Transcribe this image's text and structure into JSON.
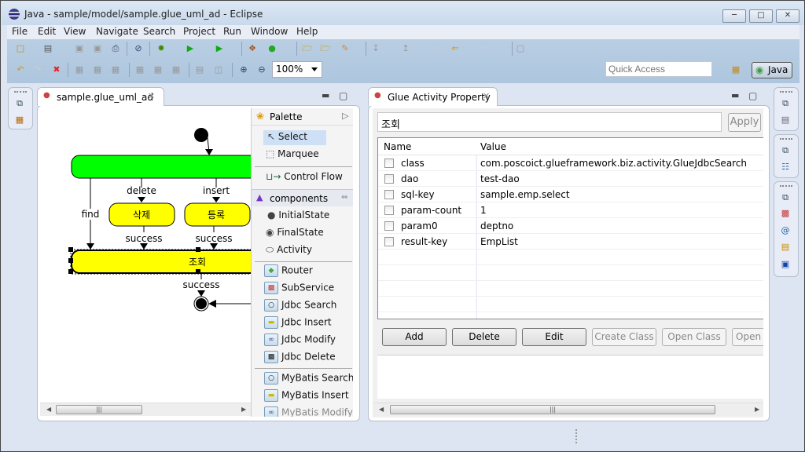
{
  "window": {
    "title": "Java - sample/model/sample.glue_uml_ad - Eclipse",
    "controls": [
      "minimize",
      "maximize",
      "close"
    ]
  },
  "menu": [
    "File",
    "Edit",
    "View",
    "Navigate",
    "Search",
    "Project",
    "Run",
    "Window",
    "Help"
  ],
  "toolbar": {
    "zoom_value": "100%",
    "quick_access_placeholder": "Quick Access",
    "perspective_label": "Java"
  },
  "editor": {
    "tab_label": "sample.glue_uml_ad",
    "diagram": {
      "nodes": [
        {
          "id": "router",
          "label": "",
          "color": "#00ff00"
        },
        {
          "id": "delete",
          "label": "삭제",
          "color": "#ffff00"
        },
        {
          "id": "insert",
          "label": "등록",
          "color": "#ffff00"
        },
        {
          "id": "search",
          "label": "조회",
          "color": "#ffff00"
        }
      ],
      "edge_labels": {
        "delete": "delete",
        "insert": "insert",
        "find": "find",
        "success1": "success",
        "success2": "success",
        "success3": "success"
      }
    },
    "palette": {
      "title": "Palette",
      "tools": [
        "Select",
        "Marquee"
      ],
      "control_flow": "Control Flow",
      "drawer_label": "components",
      "states": [
        "InitialState",
        "FinalState",
        "Activity"
      ],
      "jdbc": [
        "Router",
        "SubService",
        "Jdbc Search",
        "Jdbc Insert",
        "Jdbc Modify",
        "Jdbc Delete"
      ],
      "mybatis": [
        "MyBatis Search",
        "MyBatis Insert",
        "MyBatis Modify"
      ]
    }
  },
  "properties": {
    "tab_label": "Glue Activity Property",
    "name_value": "조회",
    "apply_label": "Apply",
    "columns": [
      "Name",
      "Value"
    ],
    "rows": [
      {
        "name": "class",
        "value": "com.poscoict.glueframework.biz.activity.GlueJdbcSearch"
      },
      {
        "name": "dao",
        "value": "test-dao"
      },
      {
        "name": "sql-key",
        "value": "sample.emp.select"
      },
      {
        "name": "param-count",
        "value": "1"
      },
      {
        "name": "param0",
        "value": "deptno"
      },
      {
        "name": "result-key",
        "value": "EmpList"
      }
    ],
    "buttons": [
      {
        "label": "Add",
        "enabled": true
      },
      {
        "label": "Delete",
        "enabled": true
      },
      {
        "label": "Edit",
        "enabled": true
      },
      {
        "label": "Create Class",
        "enabled": false
      },
      {
        "label": "Open Class",
        "enabled": false
      },
      {
        "label": "Open S",
        "enabled": false
      }
    ]
  }
}
